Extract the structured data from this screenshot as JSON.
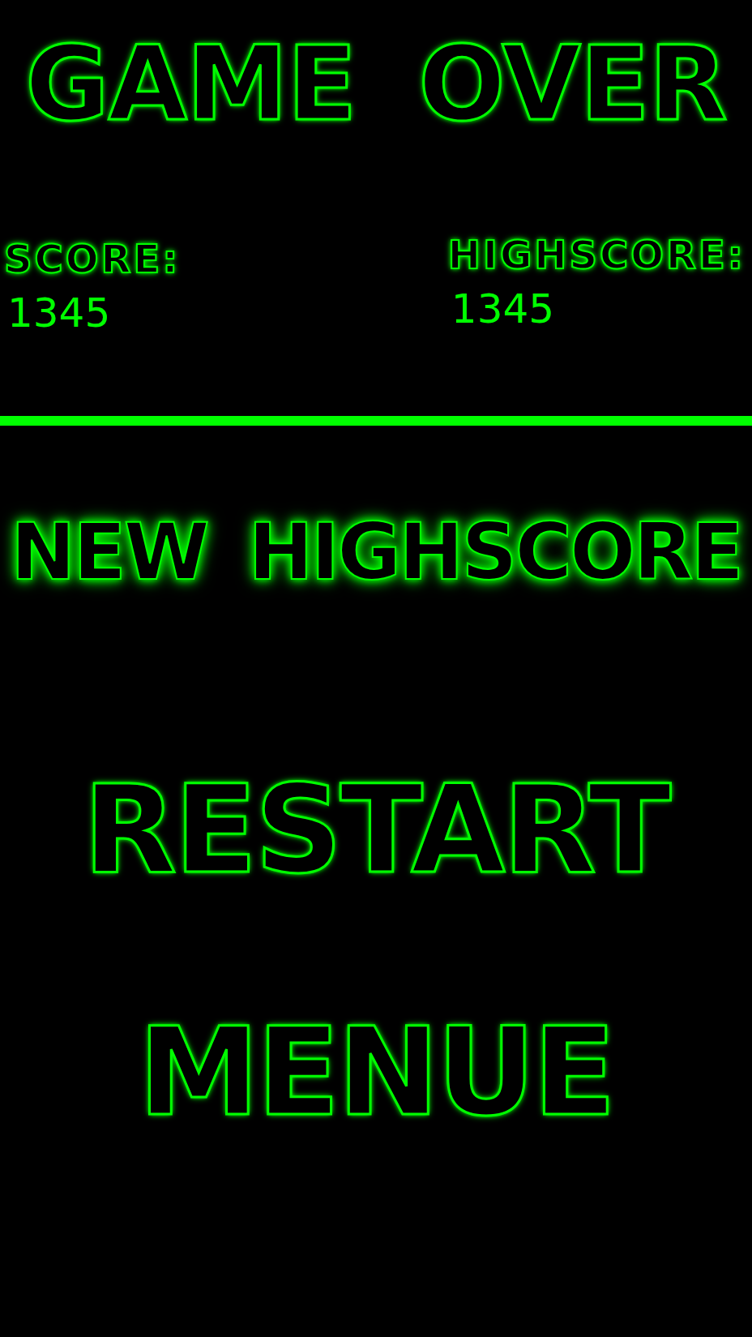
{
  "title": "GAME OVER",
  "score": {
    "label": "SCORE:",
    "value": "1345"
  },
  "highscore": {
    "label": "HIGHSCORE:",
    "value": "1345"
  },
  "banner": "NEW HIGHSCORE",
  "buttons": [
    "RESTART",
    "MENUE"
  ]
}
